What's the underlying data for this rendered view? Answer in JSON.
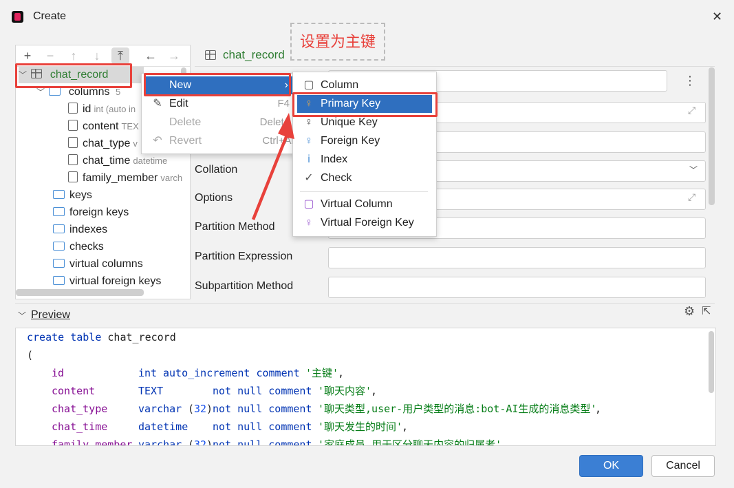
{
  "window": {
    "title": "Create"
  },
  "annotation": "设置为主键",
  "tree": {
    "root": "chat_record",
    "columns_label": "columns",
    "columns_count": "5",
    "columns": [
      {
        "name": "id",
        "type": "int (auto in"
      },
      {
        "name": "content",
        "type": "TEX"
      },
      {
        "name": "chat_type",
        "type": "v"
      },
      {
        "name": "chat_time",
        "type": "datetime"
      },
      {
        "name": "family_member",
        "type": "varch"
      }
    ],
    "folders": [
      "keys",
      "foreign keys",
      "indexes",
      "checks",
      "virtual columns",
      "virtual foreign keys"
    ]
  },
  "form": {
    "title": "chat_record",
    "labels": {
      "collation": "Collation",
      "options": "Options",
      "partition_method": "Partition Method",
      "partition_expression": "Partition Expression",
      "subpartition_method": "Subpartition Method"
    }
  },
  "context_menu": {
    "new": "New",
    "edit": "Edit",
    "edit_shortcut": "F4",
    "delete": "Delete",
    "delete_shortcut": "Delete",
    "revert": "Revert",
    "revert_shortcut": "Ctrl+Alt"
  },
  "submenu": {
    "items": [
      "Column",
      "Primary Key",
      "Unique Key",
      "Foreign Key",
      "Index",
      "Check"
    ],
    "virtual_items": [
      "Virtual Column",
      "Virtual Foreign Key"
    ]
  },
  "preview": {
    "title": "Preview",
    "line1_kw": "create table",
    "line1_name": "chat_record",
    "line2": "(",
    "rows": [
      {
        "col": "id",
        "type": "int",
        "mods": "auto_increment comment",
        "comment": "'主键'",
        "end": ","
      },
      {
        "col": "content",
        "type": "TEXT",
        "mods": "not null comment",
        "comment": "'聊天内容'",
        "end": ","
      },
      {
        "col": "chat_type",
        "type": "varchar",
        "len": "32",
        "mods": "not null comment",
        "comment": "'聊天类型,user-用户类型的消息:bot-AI生成的消息类型'",
        "end": ","
      },
      {
        "col": "chat_time",
        "type": "datetime",
        "mods": "not null comment",
        "comment": "'聊天发生的时间'",
        "end": ","
      },
      {
        "col": "family_member",
        "type": "varchar",
        "len": "32",
        "mods": "not null comment",
        "comment": "'家庭成员,用于区分聊天内容的归属者'",
        "end": ""
      }
    ]
  },
  "buttons": {
    "ok": "OK",
    "cancel": "Cancel"
  },
  "colors": {
    "highlight": "#2f6fbf",
    "annotation": "#e8413b",
    "ok_button": "#3b7fd4"
  }
}
